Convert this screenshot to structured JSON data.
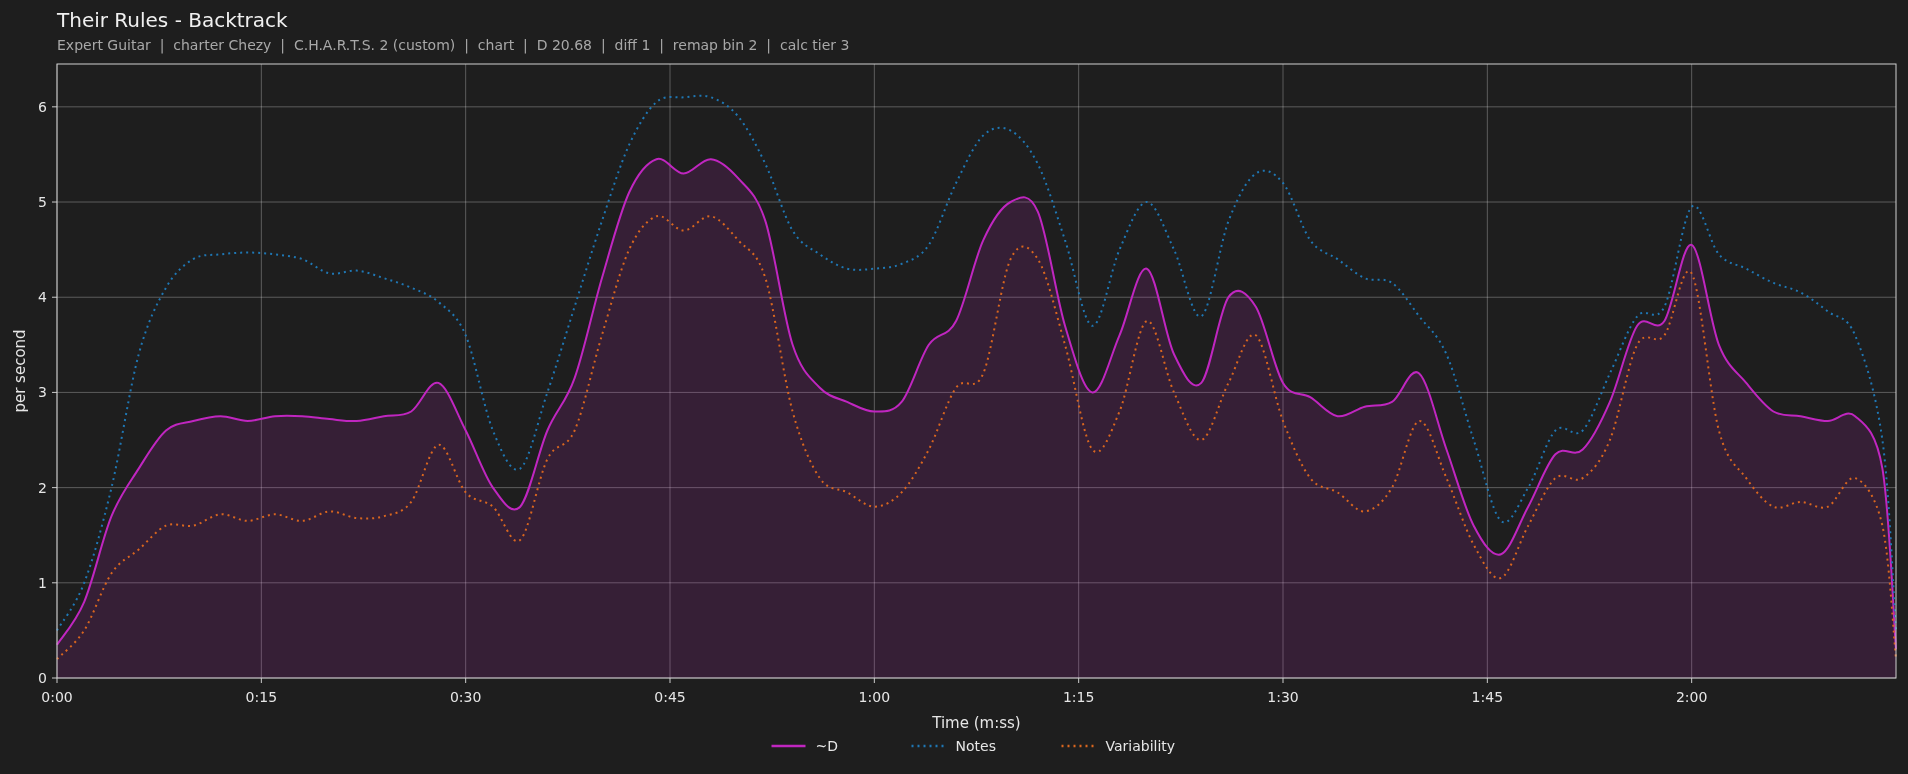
{
  "title": "Their Rules - Backtrack",
  "subtitle": "Expert Guitar  |  charter Chezy  |  C.H.A.R.T.S. 2 (custom)  |  chart  |  D 20.68  |  diff 1  |  remap bin 2  |  calc tier 3",
  "chart_data": {
    "type": "line",
    "xlabel": "Time (m:ss)",
    "ylabel": "per second",
    "x": [
      0,
      2,
      4,
      6,
      8,
      10,
      12,
      14,
      16,
      18,
      20,
      22,
      24,
      26,
      28,
      30,
      32,
      34,
      36,
      38,
      40,
      42,
      44,
      46,
      48,
      50,
      52,
      54,
      56,
      58,
      60,
      62,
      64,
      66,
      68,
      70,
      72,
      74,
      76,
      78,
      80,
      82,
      84,
      86,
      88,
      90,
      92,
      94,
      96,
      98,
      100,
      102,
      104,
      106,
      108,
      110,
      112,
      114,
      116,
      118,
      120,
      122,
      124,
      126,
      128,
      130,
      132,
      134,
      135
    ],
    "series": [
      {
        "name": "~D",
        "color": "#c026c0",
        "type": "area",
        "line_style": "solid",
        "values": [
          0.35,
          0.8,
          1.7,
          2.2,
          2.6,
          2.7,
          2.75,
          2.7,
          2.75,
          2.75,
          2.72,
          2.7,
          2.75,
          2.8,
          3.1,
          2.6,
          2.0,
          1.8,
          2.6,
          3.15,
          4.2,
          5.1,
          5.45,
          5.3,
          5.45,
          5.25,
          4.8,
          3.5,
          3.05,
          2.9,
          2.8,
          2.9,
          3.5,
          3.75,
          4.6,
          5.0,
          4.9,
          3.7,
          3.0,
          3.6,
          4.3,
          3.4,
          3.1,
          4.0,
          3.9,
          3.1,
          2.95,
          2.75,
          2.85,
          2.9,
          3.2,
          2.4,
          1.6,
          1.3,
          1.8,
          2.35,
          2.4,
          2.9,
          3.7,
          3.75,
          4.55,
          3.5,
          3.1,
          2.8,
          2.75,
          2.7,
          2.75,
          2.2,
          0.3
        ]
      },
      {
        "name": "Notes",
        "color": "#1f77b4",
        "type": "line",
        "line_style": "dotted",
        "values": [
          0.5,
          1.0,
          2.0,
          3.4,
          4.1,
          4.4,
          4.45,
          4.47,
          4.45,
          4.4,
          4.25,
          4.28,
          4.2,
          4.1,
          3.95,
          3.6,
          2.6,
          2.2,
          3.0,
          3.9,
          4.8,
          5.6,
          6.05,
          6.1,
          6.1,
          5.9,
          5.4,
          4.7,
          4.45,
          4.3,
          4.3,
          4.35,
          4.55,
          5.2,
          5.7,
          5.75,
          5.4,
          4.6,
          3.7,
          4.5,
          5.0,
          4.5,
          3.8,
          4.8,
          5.3,
          5.2,
          4.6,
          4.4,
          4.2,
          4.15,
          3.8,
          3.4,
          2.5,
          1.65,
          2.0,
          2.6,
          2.6,
          3.2,
          3.8,
          3.9,
          4.95,
          4.45,
          4.3,
          4.15,
          4.05,
          3.85,
          3.6,
          2.5,
          0.5
        ]
      },
      {
        "name": "Variability",
        "color": "#d9661f",
        "type": "line",
        "line_style": "dotted",
        "values": [
          0.2,
          0.5,
          1.1,
          1.35,
          1.6,
          1.6,
          1.72,
          1.65,
          1.72,
          1.65,
          1.75,
          1.68,
          1.7,
          1.85,
          2.45,
          1.95,
          1.8,
          1.45,
          2.3,
          2.6,
          3.6,
          4.5,
          4.85,
          4.7,
          4.85,
          4.6,
          4.2,
          2.8,
          2.1,
          1.95,
          1.8,
          1.95,
          2.4,
          3.05,
          3.2,
          4.4,
          4.4,
          3.5,
          2.4,
          2.8,
          3.75,
          3.0,
          2.5,
          3.1,
          3.6,
          2.7,
          2.1,
          1.95,
          1.75,
          2.0,
          2.7,
          2.1,
          1.4,
          1.05,
          1.6,
          2.1,
          2.1,
          2.5,
          3.5,
          3.6,
          4.25,
          2.6,
          2.1,
          1.8,
          1.85,
          1.8,
          2.1,
          1.6,
          0.2
        ]
      }
    ],
    "grid": true,
    "legend": true,
    "xlim": [
      0,
      135
    ],
    "ylim": [
      0,
      6.45
    ],
    "xticks": [
      {
        "value": 0,
        "label": "0:00"
      },
      {
        "value": 15,
        "label": "0:15"
      },
      {
        "value": 30,
        "label": "0:30"
      },
      {
        "value": 45,
        "label": "0:45"
      },
      {
        "value": 60,
        "label": "1:00"
      },
      {
        "value": 75,
        "label": "1:15"
      },
      {
        "value": 90,
        "label": "1:30"
      },
      {
        "value": 105,
        "label": "1:45"
      },
      {
        "value": 120,
        "label": "2:00"
      }
    ],
    "yticks": [
      0,
      1,
      2,
      3,
      4,
      5,
      6
    ]
  }
}
